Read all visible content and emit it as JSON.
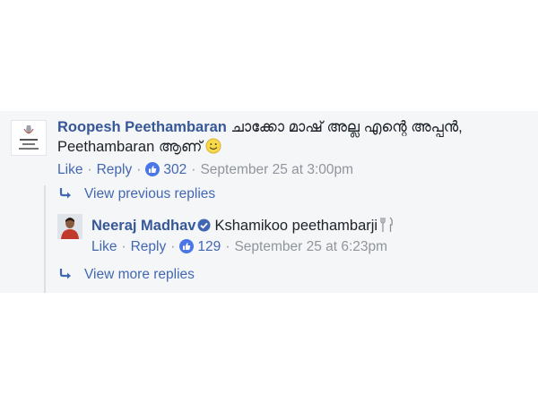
{
  "comment": {
    "author": "Roopesh Peethambaran",
    "text_line1": "ചാക്കോ മാഷ് അല്ല എന്റെ അപ്പൻ,",
    "text_line2": "Peethambaran ആണ്",
    "emoji": "smile-emoji",
    "like_label": "Like",
    "reply_label": "Reply",
    "reaction_count": "302",
    "timestamp": "September 25 at 3:00pm"
  },
  "view_previous_label": "View previous replies",
  "reply": {
    "author": "Neeraj Madhav",
    "verified": true,
    "text": "Kshamikoo peethambarji",
    "emoji": "fork-and-knife-icon",
    "like_label": "Like",
    "reply_label": "Reply",
    "reaction_count": "129",
    "timestamp": "September 25 at 6:23pm"
  },
  "view_more_label": "View more replies",
  "colors": {
    "panel_bg": "#f5f6f7",
    "link": "#4267b2",
    "author": "#365899",
    "meta": "#90949c",
    "text": "#1d2129",
    "reaction_blue": "#4a76e8"
  }
}
